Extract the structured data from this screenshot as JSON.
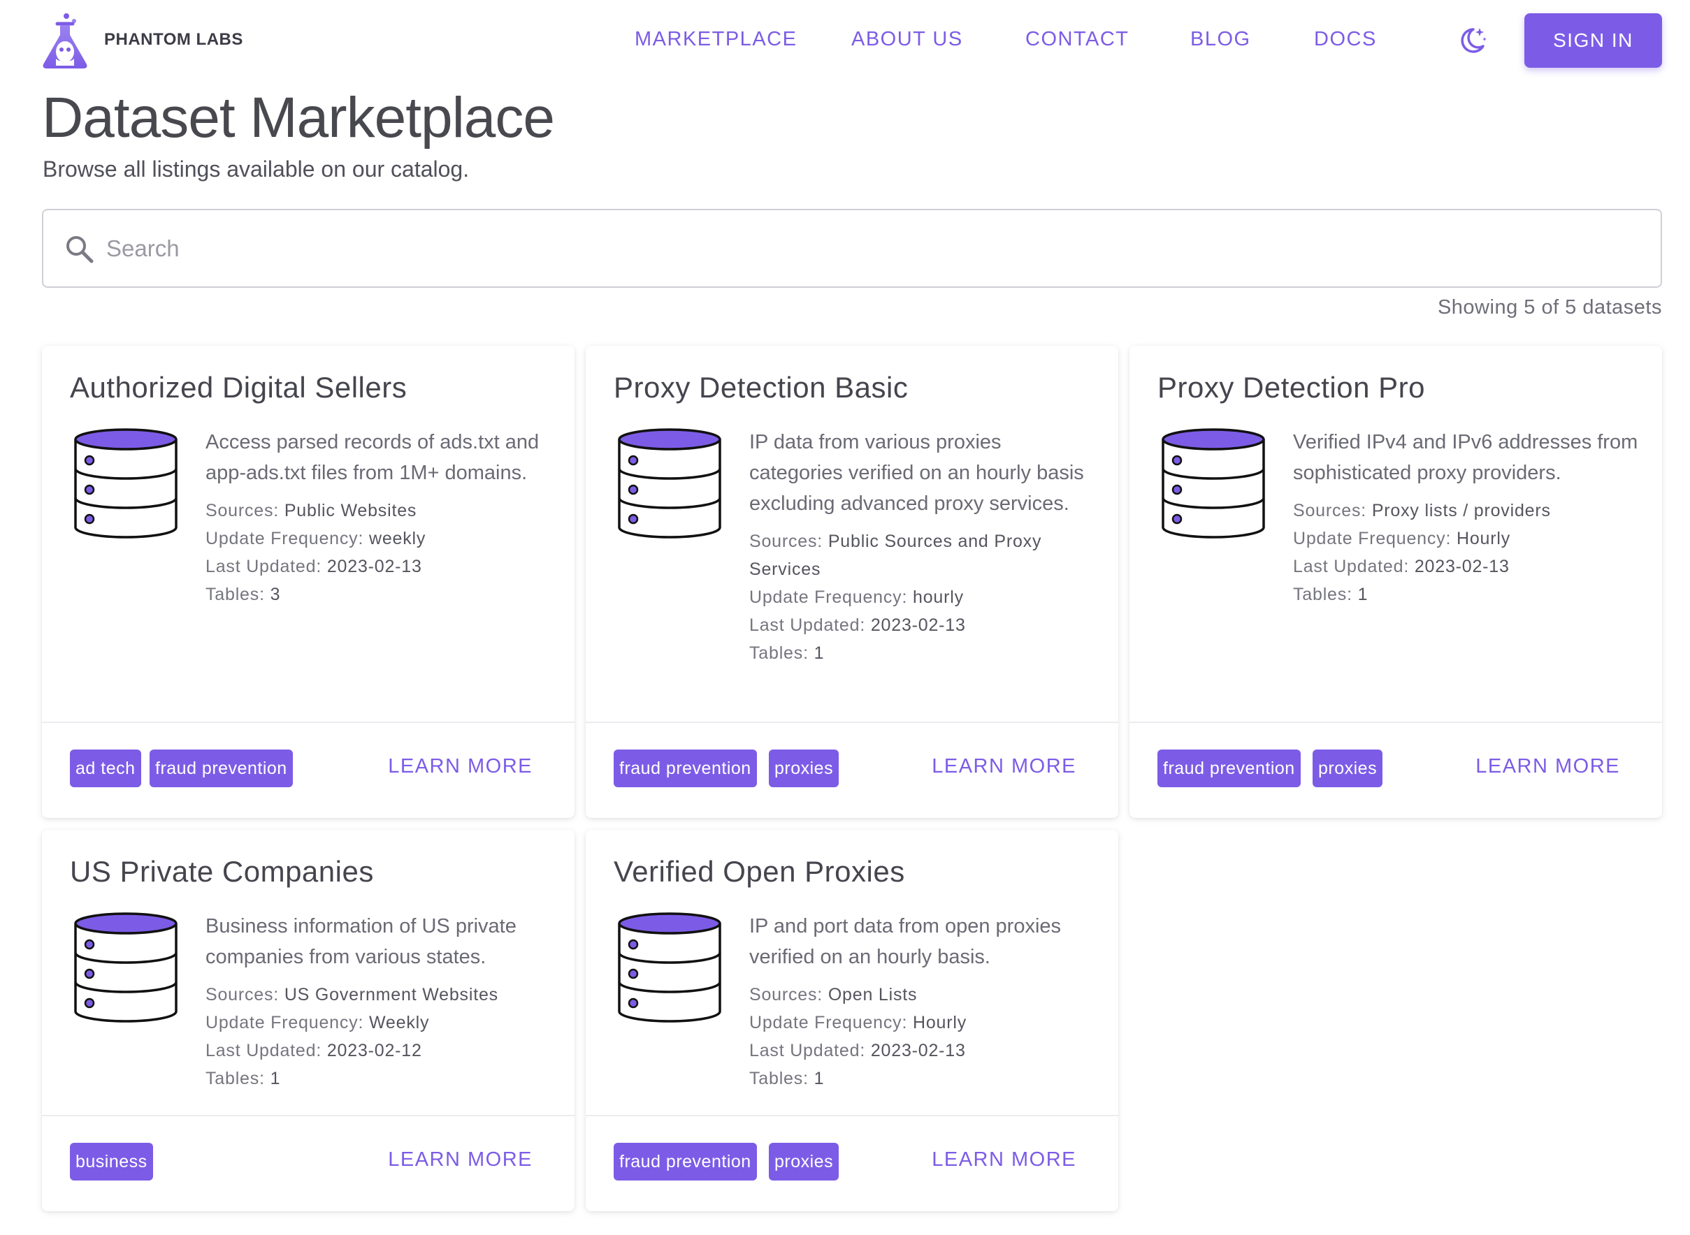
{
  "header": {
    "brand": "PHANTOM LABS",
    "nav": [
      "MARKETPLACE",
      "ABOUT US",
      "CONTACT",
      "BLOG",
      "DOCS"
    ],
    "theme_toggle_icon": "moon-star-icon",
    "signin_label": "SIGN IN"
  },
  "page": {
    "title": "Dataset Marketplace",
    "subtitle": "Browse all listings available on our catalog."
  },
  "search": {
    "placeholder": "Search",
    "value": "",
    "icon": "search-icon"
  },
  "results": {
    "count_text": "Showing 5 of 5 datasets"
  },
  "labels": {
    "sources": "Sources:",
    "update_frequency": "Update Frequency:",
    "last_updated": "Last Updated:",
    "tables": "Tables:",
    "learn_more": "LEARN MORE"
  },
  "colors": {
    "accent": "#7c5ce6",
    "text_dark": "#48484f",
    "text_muted": "#6a6a74"
  },
  "cards": [
    {
      "title": "Authorized Digital Sellers",
      "description": "Access parsed records of ads.txt and app-ads.txt files from 1M+ domains.",
      "sources": "Public Websites",
      "update_frequency": "weekly",
      "last_updated": "2023-02-13",
      "tables": "3",
      "tags": [
        "ad tech",
        "fraud prevention"
      ]
    },
    {
      "title": "Proxy Detection Basic",
      "description": "IP data from various proxies categories verified on an hourly basis excluding advanced proxy services.",
      "sources": "Public Sources and Proxy Services",
      "update_frequency": "hourly",
      "last_updated": "2023-02-13",
      "tables": "1",
      "tags": [
        "fraud prevention",
        "proxies"
      ]
    },
    {
      "title": "Proxy Detection Pro",
      "description": "Verified IPv4 and IPv6 addresses from sophisticated proxy providers.",
      "sources": "Proxy lists / providers",
      "update_frequency": "Hourly",
      "last_updated": "2023-02-13",
      "tables": "1",
      "tags": [
        "fraud prevention",
        "proxies"
      ]
    },
    {
      "title": "US Private Companies",
      "description": "Business information of US private companies from various states.",
      "sources": "US Government Websites",
      "update_frequency": "Weekly",
      "last_updated": "2023-02-12",
      "tables": "1",
      "tags": [
        "business"
      ]
    },
    {
      "title": "Verified Open Proxies",
      "description": "IP and port data from open proxies verified on an hourly basis.",
      "sources": "Open Lists",
      "update_frequency": "Hourly",
      "last_updated": "2023-02-13",
      "tables": "1",
      "tags": [
        "fraud prevention",
        "proxies"
      ]
    }
  ]
}
